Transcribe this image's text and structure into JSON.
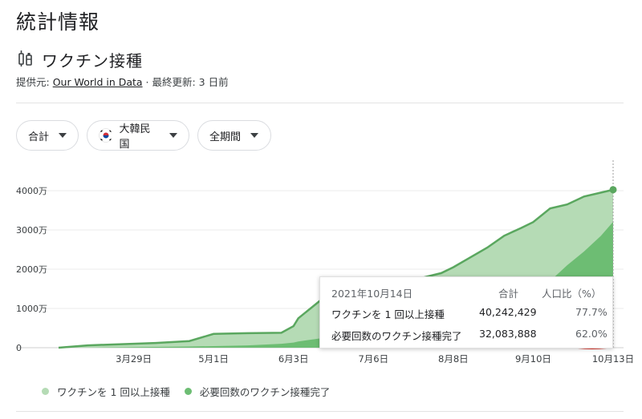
{
  "page_title": "統計情報",
  "section": {
    "title": "ワクチン接種",
    "icon": "syringe-icon"
  },
  "source": {
    "prefix": "提供元: ",
    "link": "Our World in Data",
    "updated": " · 最終更新: 3 日前"
  },
  "filters": [
    {
      "label": "合計"
    },
    {
      "label": "大韓民国",
      "flag": "south-korea-flag-icon"
    },
    {
      "label": "全期間"
    }
  ],
  "tooltip": {
    "date": "2021年10月14日",
    "col_total": "合計",
    "col_ratio": "人口比（%）",
    "rows": [
      {
        "label": "ワクチンを 1 回以上接種",
        "value": "40,242,429",
        "pct": "77.7%"
      },
      {
        "label": "必要回数のワクチン接種完了",
        "value": "32,083,888",
        "pct": "62.0%"
      }
    ]
  },
  "colors": {
    "light_fill": "#b5dbb5",
    "dark_fill": "#6dbd73",
    "line": "#5aa75f",
    "annotation": "#e8342a"
  },
  "chart_data": {
    "type": "area",
    "x_unit": "date",
    "x": [
      "2021-02-26",
      "2021-03-10",
      "2021-03-24",
      "2021-04-07",
      "2021-04-21",
      "2021-05-01",
      "2021-05-15",
      "2021-05-29",
      "2021-06-03",
      "2021-06-05",
      "2021-06-12",
      "2021-06-19",
      "2021-06-26",
      "2021-07-06",
      "2021-07-13",
      "2021-07-24",
      "2021-08-03",
      "2021-08-08",
      "2021-08-15",
      "2021-08-22",
      "2021-08-29",
      "2021-09-05",
      "2021-09-10",
      "2021-09-17",
      "2021-09-24",
      "2021-10-01",
      "2021-10-08",
      "2021-10-13"
    ],
    "series": [
      {
        "name": "ワクチンを 1 回以上接種",
        "values": [
          0.0,
          0.6,
          0.9,
          1.2,
          1.7,
          3.5,
          3.7,
          3.8,
          5.5,
          7.5,
          11.0,
          14.5,
          15.5,
          15.7,
          15.8,
          17.5,
          19.0,
          20.5,
          23.0,
          25.5,
          28.5,
          30.5,
          32.0,
          35.5,
          36.5,
          38.5,
          39.5,
          40.24
        ]
      },
      {
        "name": "必要回数のワクチン接種完了",
        "values": [
          0.0,
          0.0,
          0.1,
          0.2,
          0.3,
          0.4,
          0.6,
          1.0,
          1.3,
          1.6,
          2.2,
          2.8,
          3.2,
          3.5,
          3.7,
          4.0,
          4.8,
          5.5,
          6.5,
          8.0,
          9.5,
          11.0,
          13.5,
          17.0,
          21.0,
          24.5,
          28.5,
          32.08
        ]
      }
    ],
    "y_ticks": [
      {
        "value": 0,
        "label": "0"
      },
      {
        "value": 10,
        "label": "1000万"
      },
      {
        "value": 20,
        "label": "2000万"
      },
      {
        "value": 30,
        "label": "3000万"
      },
      {
        "value": 40,
        "label": "4000万"
      }
    ],
    "x_ticks": [
      {
        "date": "2021-03-29",
        "label": "3月29日"
      },
      {
        "date": "2021-05-01",
        "label": "5月1日"
      },
      {
        "date": "2021-06-03",
        "label": "6月3日"
      },
      {
        "date": "2021-07-06",
        "label": "7月6日"
      },
      {
        "date": "2021-08-08",
        "label": "8月8日"
      },
      {
        "date": "2021-09-10",
        "label": "9月10日"
      },
      {
        "date": "2021-10-13",
        "label": "10月13日"
      }
    ],
    "ylim": [
      0,
      40
    ],
    "grid": true,
    "legend": "bottom-left"
  }
}
